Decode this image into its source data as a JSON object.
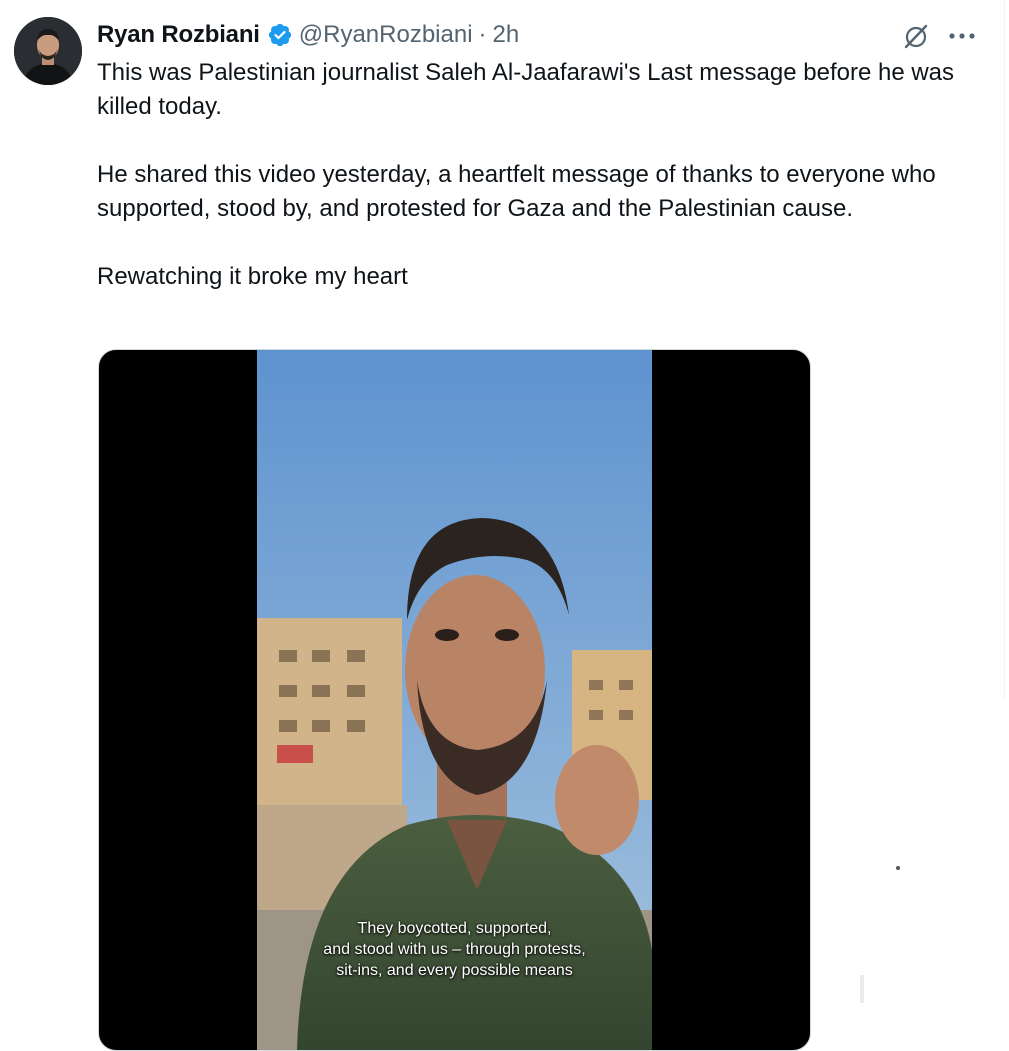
{
  "tweet": {
    "author": {
      "display_name": "Ryan Rozbiani",
      "handle": "@RyanRozbiani",
      "verified": true,
      "avatar_icon": "profile-photo"
    },
    "separator": "·",
    "timestamp": "2h",
    "paragraphs": [
      "This was Palestinian journalist Saleh Al-Jaafarawi's Last message before he was killed today.",
      "He shared this video yesterday, a heartfelt message of thanks to everyone who supported, stood by, and protested for Gaza and the Palestinian cause.",
      "Rewatching it broke my heart"
    ],
    "actions": {
      "grok_icon": "grok-icon",
      "more_icon": "more-options-icon"
    },
    "media": {
      "type": "video",
      "caption_lines": [
        "They boycotted, supported,",
        "and stood with us – through protests,",
        "sit-ins, and every possible means"
      ]
    }
  },
  "colors": {
    "text": "#0f1419",
    "secondary": "#536471",
    "verified_blue": "#1d9bf0",
    "sky": "#6f9ed3"
  }
}
